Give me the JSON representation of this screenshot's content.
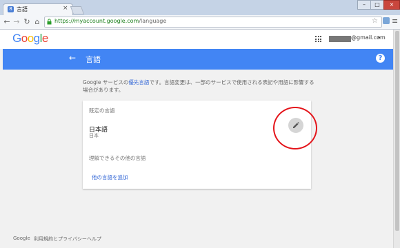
{
  "browser": {
    "tab_title": "言語",
    "tab_favicon": "8",
    "url_host": "https://myaccount.google.com",
    "url_path": "/language"
  },
  "header": {
    "logo_letters": [
      "G",
      "o",
      "o",
      "g",
      "l",
      "e"
    ],
    "logo_colors": [
      "#4285f4",
      "#ea4335",
      "#fbbc05",
      "#4285f4",
      "#34a853",
      "#ea4335"
    ],
    "account_suffix": "@gmail.com"
  },
  "bar": {
    "title": "言語",
    "color": "#4285f4"
  },
  "description": {
    "part1": "Google サービスの",
    "link": "優先言語",
    "part2": "です。言語変更は、一部のサービスで使用される表記や用語に影響する場合があります。"
  },
  "card": {
    "default_label": "既定の言語",
    "language": "日本語",
    "region": "日本",
    "other_label": "理解できるその他の言語",
    "add_link": "他の言語を追加"
  },
  "annotation": {
    "circle_color": "#e4141a"
  },
  "footer": {
    "items": [
      "Google",
      "利用規約とプライバシー",
      "ヘルプ"
    ]
  }
}
